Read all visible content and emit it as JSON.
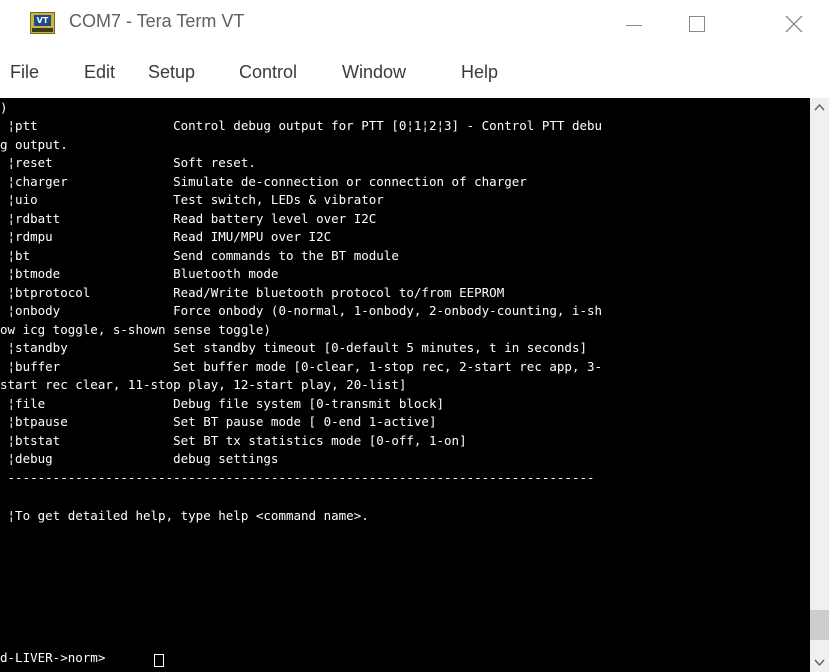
{
  "window": {
    "title": "COM7 - Tera Term VT",
    "icon": "teraterm-app-icon",
    "controls": [
      "minimize-icon",
      "maximize-icon",
      "close-icon"
    ]
  },
  "menubar": {
    "items": [
      "File",
      "Edit",
      "Setup",
      "Control",
      "Window",
      "Help"
    ]
  },
  "terminal": {
    "lines": [
      ")",
      " ¦ptt                  Control debug output for PTT [0¦1¦2¦3] - Control PTT debu",
      "g output.",
      " ¦reset                Soft reset.",
      " ¦charger              Simulate de-connection or connection of charger",
      " ¦uio                  Test switch, LEDs & vibrator",
      " ¦rdbatt               Read battery level over I2C",
      " ¦rdmpu                Read IMU/MPU over I2C",
      " ¦bt                   Send commands to the BT module",
      " ¦btmode               Bluetooth mode",
      " ¦btprotocol           Read/Write bluetooth protocol to/from EEPROM",
      " ¦onbody               Force onbody (0-normal, 1-onbody, 2-onbody-counting, i-sh",
      "ow icg toggle, s-shown sense toggle)",
      " ¦standby              Set standby timeout [0-default 5 minutes, t in seconds]",
      " ¦buffer               Set buffer mode [0-clear, 1-stop rec, 2-start rec app, 3-",
      "start rec clear, 11-stop play, 12-start play, 20-list]",
      " ¦file                 Debug file system [0-transmit block]",
      " ¦btpause              Set BT pause mode [ 0-end 1-active]",
      " ¦btstat               Set BT tx statistics mode [0-off, 1-on]",
      " ¦debug                debug settings",
      " ------------------------------------------------------------------------------",
      "",
      " ¦To get detailed help, type help <command name>.",
      "",
      "",
      "d-LIVER->norm> "
    ],
    "text_color": "#ffffff",
    "background_color": "#000000"
  },
  "scrollbar": {
    "up_icon": "scroll-up-arrow-icon",
    "down_icon": "scroll-down-arrow-icon"
  }
}
